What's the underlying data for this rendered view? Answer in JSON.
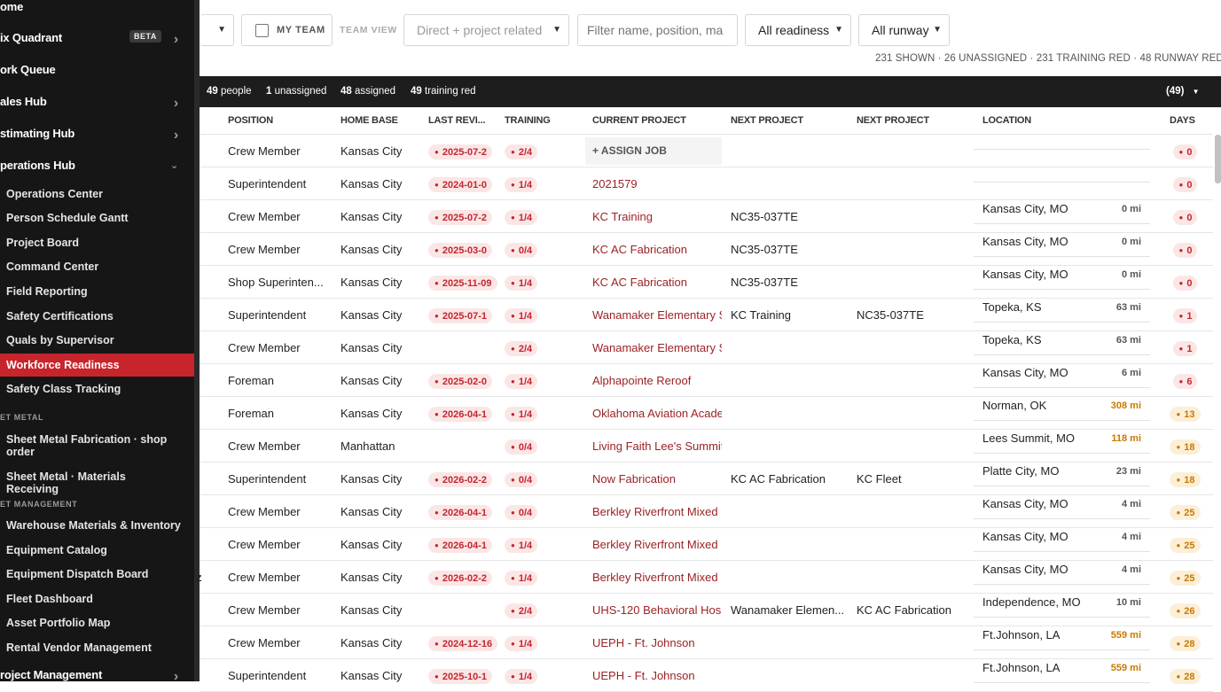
{
  "sidebar": {
    "top_items": [
      {
        "label": "ome",
        "chevron": false
      },
      {
        "label": "ix Quadrant",
        "badge": "BETA",
        "chevron": true
      },
      {
        "label": "ork Queue",
        "chevron": false
      },
      {
        "label": "ales Hub",
        "chevron": true
      },
      {
        "label": "stimating Hub",
        "chevron": true
      },
      {
        "label": "perations Hub",
        "chevron": true
      }
    ],
    "ops_items": [
      "Operations Center",
      "Person Schedule Gantt",
      "Project Board",
      "Command Center",
      "Field Reporting",
      "Safety Certifications",
      "Quals by Supervisor",
      "Workforce Readiness",
      "Safety Class Tracking"
    ],
    "section_sheet": "ET METAL",
    "sheet_items": [
      "Sheet Metal Fabrication · shop order",
      "Sheet Metal · Materials Receiving"
    ],
    "section_asset": "ET MANAGEMENT",
    "asset_items": [
      "Warehouse Materials & Inventory",
      "Equipment Catalog",
      "Equipment Dispatch Board",
      "Fleet Dashboard",
      "Asset Portfolio Map",
      "Rental Vendor Management"
    ],
    "bottom_item": "roject Management"
  },
  "toolbar": {
    "my_team": "MY TEAM",
    "team_view": "TEAM VIEW",
    "relation_select": "Direct + project related",
    "filter_placeholder": "Filter name, position, ma",
    "readiness_select": "All readiness",
    "runway_select": "All runway",
    "summary": "231 SHOWN · 26 UNASSIGNED · 231 TRAINING RED · 48 RUNWAY RED"
  },
  "statsbar": {
    "people_n": "49",
    "people_l": "people",
    "unassigned_n": "1",
    "unassigned_l": "unassigned",
    "assigned_n": "48",
    "assigned_l": "assigned",
    "red_n": "49",
    "red_l": "training red",
    "count": "(49)"
  },
  "columns": {
    "position": "POSITION",
    "home_base": "HOME BASE",
    "last_review": "LAST REVI...",
    "training": "TRAINING",
    "current_project": "CURRENT PROJECT",
    "next_project": "NEXT PROJECT",
    "next_project2": "NEXT PROJECT",
    "location": "LOCATION",
    "days": "DAYS"
  },
  "assign_label": "+ ASSIGN JOB",
  "status_colors": {
    "red": "#c4262e",
    "orange": "#c87a00",
    "accent": "#c8242c"
  },
  "rows": [
    {
      "position": "Crew Member",
      "home": "Kansas City",
      "review": "2025-07-2",
      "training": "2/4",
      "current": "",
      "next1": "",
      "next2": "",
      "location": "",
      "miles": "",
      "days": "0",
      "days_color": "red",
      "assign": true
    },
    {
      "position": "Superintendent",
      "home": "Kansas City",
      "review": "2024-01-0",
      "training": "1/4",
      "current": "2021579",
      "next1": "",
      "next2": "",
      "location": "",
      "miles": "",
      "days": "0",
      "days_color": "red"
    },
    {
      "position": "Crew Member",
      "home": "Kansas City",
      "review": "2025-07-2",
      "training": "1/4",
      "current": "KC Training",
      "next1": "NC35-037TE",
      "next2": "",
      "location": "Kansas City, MO",
      "miles": "0 mi",
      "days": "0",
      "days_color": "red"
    },
    {
      "position": "Crew Member",
      "home": "Kansas City",
      "review": "2025-03-0",
      "training": "0/4",
      "current": "KC AC Fabrication",
      "next1": "NC35-037TE",
      "next2": "",
      "location": "Kansas City, MO",
      "miles": "0 mi",
      "days": "0",
      "days_color": "red"
    },
    {
      "position": "Shop Superinten...",
      "home": "Kansas City",
      "review": "2025-11-09",
      "training": "1/4",
      "current": "KC AC Fabrication",
      "next1": "NC35-037TE",
      "next2": "",
      "location": "Kansas City, MO",
      "miles": "0 mi",
      "days": "0",
      "days_color": "red"
    },
    {
      "position": "Superintendent",
      "home": "Kansas City",
      "review": "2025-07-1",
      "training": "1/4",
      "current": "Wanamaker Elementary S",
      "next1": "KC Training",
      "next2": "NC35-037TE",
      "location": "Topeka, KS",
      "miles": "63 mi",
      "days": "1",
      "days_color": "red"
    },
    {
      "position": "Crew Member",
      "home": "Kansas City",
      "review": "",
      "training": "2/4",
      "current": "Wanamaker Elementary S",
      "next1": "",
      "next2": "",
      "location": "Topeka, KS",
      "miles": "63 mi",
      "days": "1",
      "days_color": "red"
    },
    {
      "position": "Foreman",
      "home": "Kansas City",
      "review": "2025-02-0",
      "training": "1/4",
      "current": "Alphapointe Reroof",
      "next1": "",
      "next2": "",
      "location": "Kansas City, MO",
      "miles": "6 mi",
      "days": "6",
      "days_color": "red"
    },
    {
      "position": "Foreman",
      "home": "Kansas City",
      "review": "2026-04-1",
      "training": "1/4",
      "current": "Oklahoma Aviation Acade",
      "next1": "",
      "next2": "",
      "location": "Norman, OK",
      "miles": "308 mi",
      "miles_color": "orange",
      "days": "13",
      "days_color": "orange"
    },
    {
      "position": "Crew Member",
      "home": "Manhattan",
      "review": "",
      "training": "0/4",
      "current": "Living Faith Lee's Summit",
      "next1": "",
      "next2": "",
      "location": "Lees Summit, MO",
      "miles": "118 mi",
      "miles_color": "orange",
      "days": "18",
      "days_color": "orange"
    },
    {
      "position": "Superintendent",
      "home": "Kansas City",
      "review": "2026-02-2",
      "training": "0/4",
      "current": "Now Fabrication",
      "next1": "KC AC Fabrication",
      "next2": "KC Fleet",
      "location": "Platte City, MO",
      "miles": "23 mi",
      "days": "18",
      "days_color": "orange"
    },
    {
      "position": "Crew Member",
      "home": "Kansas City",
      "review": "2026-04-1",
      "training": "0/4",
      "current": "Berkley Riverfront Mixed",
      "next1": "",
      "next2": "",
      "location": "Kansas City, MO",
      "miles": "4 mi",
      "days": "25",
      "days_color": "orange"
    },
    {
      "position": "Crew Member",
      "home": "Kansas City",
      "review": "2026-04-1",
      "training": "1/4",
      "current": "Berkley Riverfront Mixed",
      "next1": "",
      "next2": "",
      "location": "Kansas City, MO",
      "miles": "4 mi",
      "days": "25",
      "days_color": "orange"
    },
    {
      "position": "Crew Member",
      "home": "Kansas City",
      "review": "2026-02-2",
      "training": "1/4",
      "current": "Berkley Riverfront Mixed",
      "next1": "",
      "next2": "",
      "location": "Kansas City, MO",
      "miles": "4 mi",
      "days": "25",
      "days_color": "orange",
      "name_frag": "z"
    },
    {
      "position": "Crew Member",
      "home": "Kansas City",
      "review": "",
      "training": "2/4",
      "current": "UHS-120 Behavioral Hosp",
      "next1": "Wanamaker Elemen...",
      "next2": "KC AC Fabrication",
      "location": "Independence, MO",
      "miles": "10 mi",
      "days": "26",
      "days_color": "orange"
    },
    {
      "position": "Crew Member",
      "home": "Kansas City",
      "review": "2024-12-16",
      "training": "1/4",
      "current": "UEPH - Ft. Johnson",
      "next1": "",
      "next2": "",
      "location": "Ft.Johnson, LA",
      "miles": "559 mi",
      "miles_color": "orange",
      "days": "28",
      "days_color": "orange"
    },
    {
      "position": "Superintendent",
      "home": "Kansas City",
      "review": "2025-10-1",
      "training": "1/4",
      "current": "UEPH - Ft. Johnson",
      "next1": "",
      "next2": "",
      "location": "Ft.Johnson, LA",
      "miles": "559 mi",
      "miles_color": "orange",
      "days": "28",
      "days_color": "orange"
    }
  ]
}
